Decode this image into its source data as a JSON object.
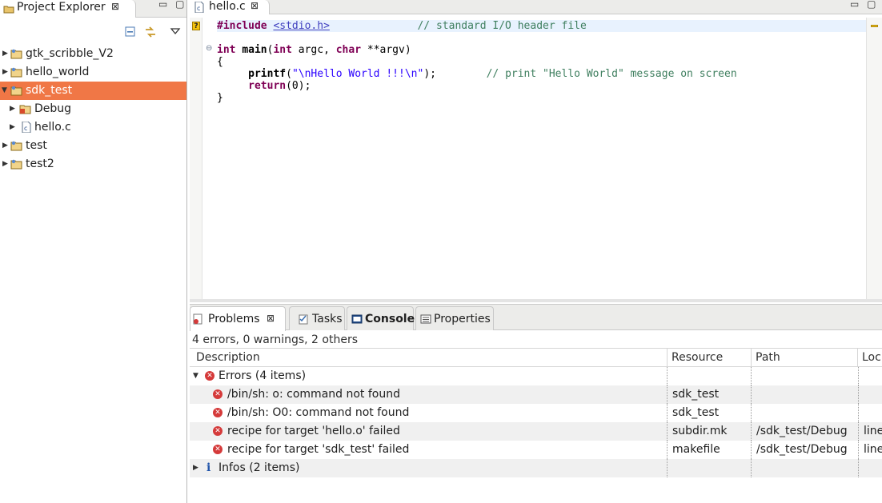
{
  "project_explorer": {
    "tab_label": "Project Explorer",
    "close_glyph": "⊠",
    "minimize_glyph": "▭",
    "maximize_glyph": "▢",
    "tree": [
      {
        "label": "gtk_scribble_V2",
        "icon": "project-folder-icon",
        "depth": 0,
        "expanded": false,
        "selected": false
      },
      {
        "label": "hello_world",
        "icon": "project-folder-icon",
        "depth": 0,
        "expanded": false,
        "selected": false
      },
      {
        "label": "sdk_test",
        "icon": "project-folder-icon",
        "depth": 0,
        "expanded": true,
        "selected": true
      },
      {
        "label": "Debug",
        "icon": "debug-folder-icon",
        "depth": 1,
        "expanded": false,
        "selected": false
      },
      {
        "label": "hello.c",
        "icon": "c-file-icon",
        "depth": 1,
        "expanded": false,
        "selected": false
      },
      {
        "label": "test",
        "icon": "project-folder-icon",
        "depth": 0,
        "expanded": false,
        "selected": false
      },
      {
        "label": "test2",
        "icon": "project-folder-icon",
        "depth": 0,
        "expanded": false,
        "selected": false
      }
    ]
  },
  "editor": {
    "tab_label": "hello.c",
    "close_glyph": "⊠",
    "code": {
      "line1_directive": "#include",
      "line1_header": "<stdio.h>",
      "line1_comment": "// standard I/O header file",
      "line2_kw_int": "int",
      "line2_fn": "main",
      "line2_open": "(",
      "line2_kw_int2": "int",
      "line2_argc": " argc, ",
      "line2_kw_char": "char",
      "line2_argv": " **argv)",
      "line3": "{",
      "line4_fn": "printf",
      "line4_open": "(",
      "line4_str": "\"\\nHello World !!!\\n\"",
      "line4_close": ");",
      "line4_comment": "// print \"Hello World\" message on screen",
      "line5_kw": "return",
      "line5_rest": "(0);",
      "line6": "}"
    }
  },
  "bottom_panel": {
    "tabs": [
      {
        "label": "Problems",
        "active": true,
        "close": "⊠"
      },
      {
        "label": "Tasks",
        "active": false
      },
      {
        "label": "Console",
        "active": false,
        "bold": true
      },
      {
        "label": "Properties",
        "active": false
      }
    ],
    "summary": "4 errors, 0 warnings, 2 others",
    "columns": [
      "Description",
      "Resource",
      "Path",
      "Loc"
    ],
    "groups": [
      {
        "label": "Errors (4 items)",
        "expanded": true
      },
      {
        "label": "Infos (2 items)",
        "expanded": false
      }
    ],
    "errors": [
      {
        "description": "/bin/sh: o: command not found",
        "resource": "sdk_test",
        "path": "",
        "location": ""
      },
      {
        "description": "/bin/sh: O0: command not found",
        "resource": "sdk_test",
        "path": "",
        "location": ""
      },
      {
        "description": "recipe for target 'hello.o' failed",
        "resource": "subdir.mk",
        "path": "/sdk_test/Debug",
        "location": "line"
      },
      {
        "description": "recipe for target 'sdk_test' failed",
        "resource": "makefile",
        "path": "/sdk_test/Debug",
        "location": "line"
      }
    ]
  },
  "colors": {
    "selection": "#f07746",
    "keyword": "#7f0055",
    "comment": "#3f7f5f",
    "string": "#2a00ff",
    "error": "#d53a3a"
  }
}
